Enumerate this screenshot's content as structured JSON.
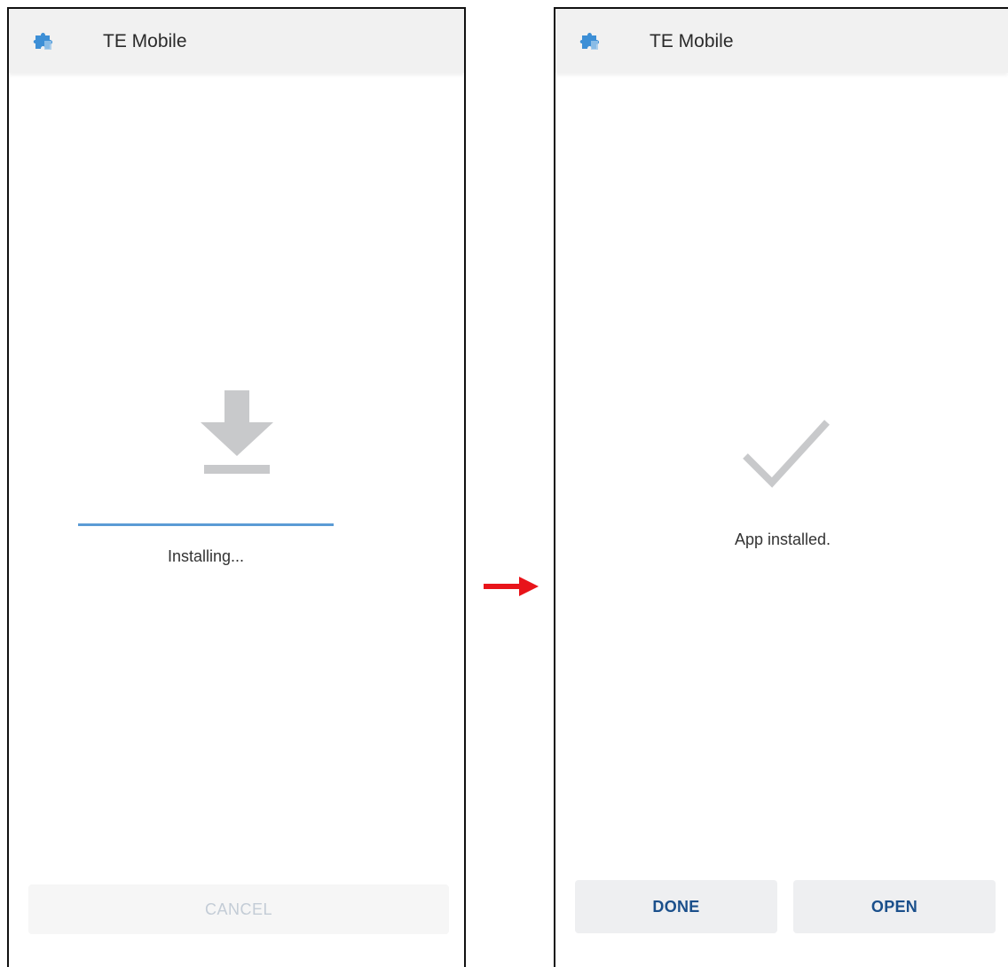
{
  "screens": [
    {
      "app_title": "TE Mobile",
      "status": "Installing...",
      "progress": 1.0,
      "cancel_label": "CANCEL",
      "icon": "download-icon"
    },
    {
      "app_title": "TE Mobile",
      "status": "App installed.",
      "done_label": "DONE",
      "open_label": "OPEN",
      "icon": "checkmark-icon"
    }
  ],
  "colors": {
    "accent_blue": "#5b9bd5",
    "button_text_blue": "#1a4f8b",
    "arrow_red": "#e8141a",
    "icon_gray": "#c8c9cb"
  }
}
